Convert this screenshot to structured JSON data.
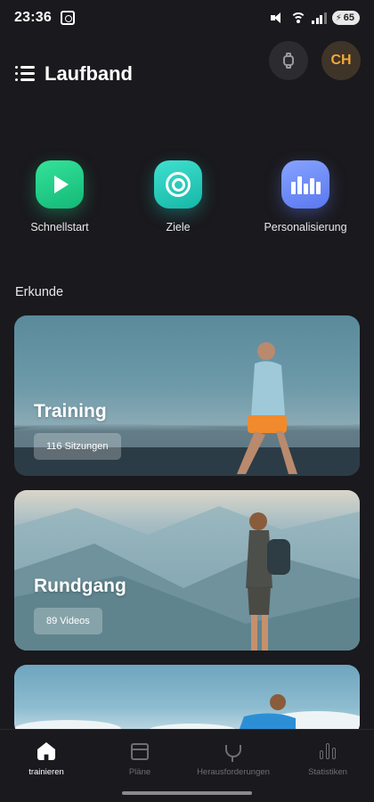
{
  "status_bar": {
    "time": "23:36",
    "battery": "65"
  },
  "header": {
    "title": "Laufband",
    "avatar_initials": "CH"
  },
  "quick_actions": [
    {
      "label": "Schnellstart",
      "icon": "play-icon",
      "color": "#22c985"
    },
    {
      "label": "Ziele",
      "icon": "target-icon",
      "color": "#22c9b9"
    },
    {
      "label": "Personalisierung",
      "icon": "bars-icon",
      "color": "#6f8cf8"
    }
  ],
  "section": {
    "title": "Erkunde"
  },
  "cards": [
    {
      "title": "Training",
      "badge": "116 Sitzungen"
    },
    {
      "title": "Rundgang",
      "badge": "89 Videos"
    }
  ],
  "bottom_nav": [
    {
      "label": "trainieren",
      "icon": "home-icon",
      "active": true
    },
    {
      "label": "Pläne",
      "icon": "calendar-icon",
      "active": false
    },
    {
      "label": "Herausforderungen",
      "icon": "trophy-icon",
      "active": false
    },
    {
      "label": "Statistiken",
      "icon": "stats-icon",
      "active": false
    }
  ]
}
